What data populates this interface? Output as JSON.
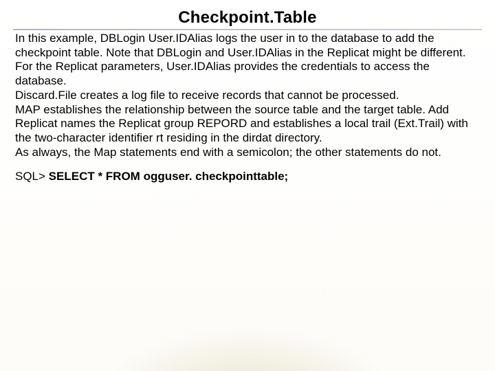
{
  "title": "Checkpoint.Table",
  "body": {
    "p1": "In this example, DBLogin User.IDAlias logs the user in to the database to add the checkpoint table. Note that DBLogin and User.IDAlias in the Replicat might be different. For the Replicat parameters, User.IDAlias provides the credentials to access the database.",
    "p2": "Discard.File creates a log file to receive records that cannot be processed.",
    "p3": "MAP establishes the relationship between the source table and the target table. Add Replicat names the Replicat group REPORD and establishes a local trail (Ext.Trail) with the two-character identifier rt residing in the dirdat directory.",
    "p4": "As always, the Map statements end with a semicolon; the other statements do not."
  },
  "sql": {
    "prompt": "SQL> ",
    "stmt": "SELECT * FROM ogguser. checkpointtable;"
  }
}
